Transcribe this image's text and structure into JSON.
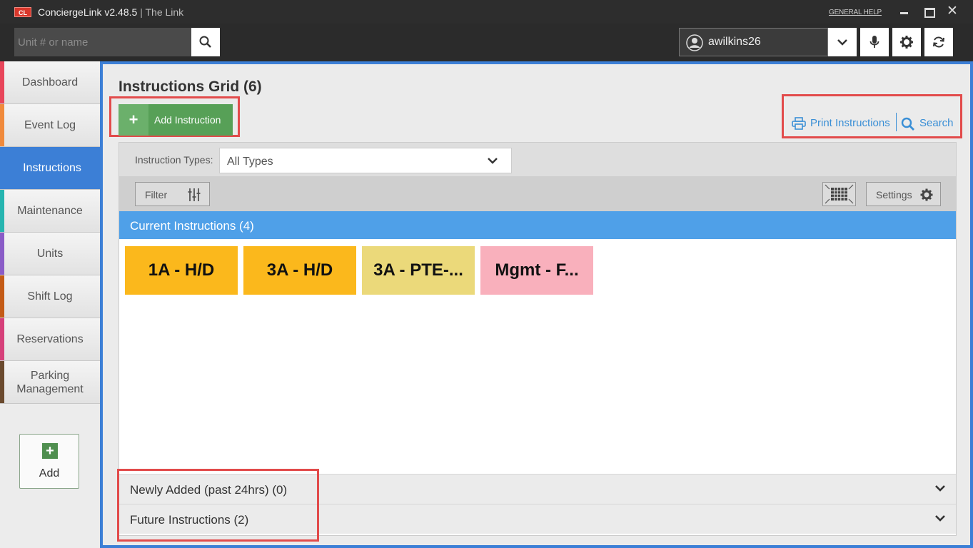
{
  "app": {
    "logo": "CL",
    "name": "ConciergeLink v2.48.5",
    "separator": "|",
    "subtitle": "The Link",
    "general_help": "GENERAL HELP"
  },
  "toolbar": {
    "search_placeholder": "Unit # or name",
    "username": "awilkins26"
  },
  "sidebar": {
    "items": [
      {
        "label": "Dashboard",
        "stripe": "#e8455a"
      },
      {
        "label": "Event Log",
        "stripe": "#f08a3c"
      },
      {
        "label": "Instructions",
        "stripe": "#3c7fd6"
      },
      {
        "label": "Maintenance",
        "stripe": "#26b5b0"
      },
      {
        "label": "Units",
        "stripe": "#8a5cc7"
      },
      {
        "label": "Shift Log",
        "stripe": "#c45b16"
      },
      {
        "label": "Reservations",
        "stripe": "#d6407a"
      },
      {
        "label": "Parking Management",
        "stripe": "#6b4a2e"
      }
    ],
    "add_label": "Add",
    "active": "Instructions"
  },
  "main": {
    "title": "Instructions Grid (6)",
    "add_button": "Add Instruction",
    "print_link": "Print Instructions",
    "search_link": "Search",
    "types_label": "Instruction Types:",
    "types_value": "All Types",
    "filter_label": "Filter",
    "settings_label": "Settings",
    "current_header": "Current Instructions (4)",
    "cards": [
      {
        "label": "1A - H/D",
        "color": "#fbb81c"
      },
      {
        "label": "3A - H/D",
        "color": "#fbb81c"
      },
      {
        "label": "3A - PTE-...",
        "color": "#ebd97a"
      },
      {
        "label": "Mgmt - F...",
        "color": "#f9b0bc"
      }
    ],
    "newly_added": "Newly Added (past 24hrs) (0)",
    "future": "Future Instructions (2)"
  }
}
